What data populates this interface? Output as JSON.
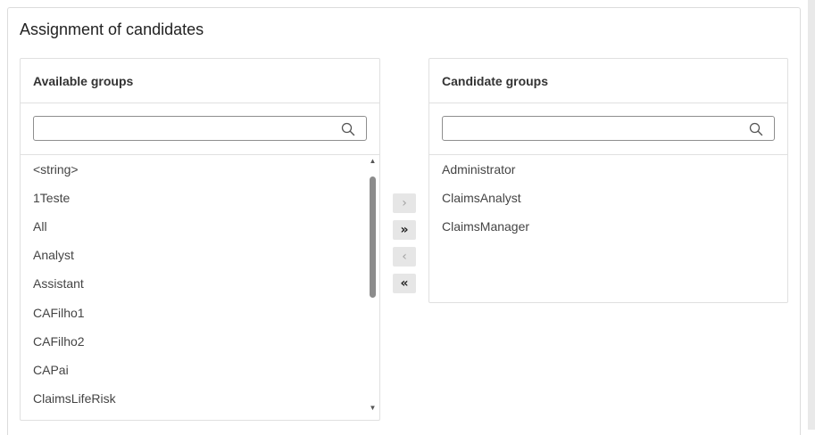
{
  "section": {
    "title": "Assignment of candidates"
  },
  "available": {
    "header": "Available groups",
    "search_value": "",
    "items": [
      "<string>",
      "1Teste",
      "All",
      "Analyst",
      "Assistant",
      "CAFilho1",
      "CAFilho2",
      "CAPai",
      "ClaimsLifeRisk"
    ]
  },
  "candidate": {
    "header": "Candidate groups",
    "search_value": "",
    "items": [
      "Administrator",
      "ClaimsAnalyst",
      "ClaimsManager"
    ]
  },
  "transfer": {
    "move_selected": "›",
    "move_all": "»",
    "remove_selected": "‹",
    "remove_all": "«"
  },
  "icons": {
    "search": "search-icon",
    "scroll_up": "triangle-up-icon",
    "scroll_down": "triangle-down-icon"
  },
  "colors": {
    "border": "#e0e0e0",
    "button_bg": "#e6e6e6",
    "scroll_thumb": "#8c8c8c"
  }
}
